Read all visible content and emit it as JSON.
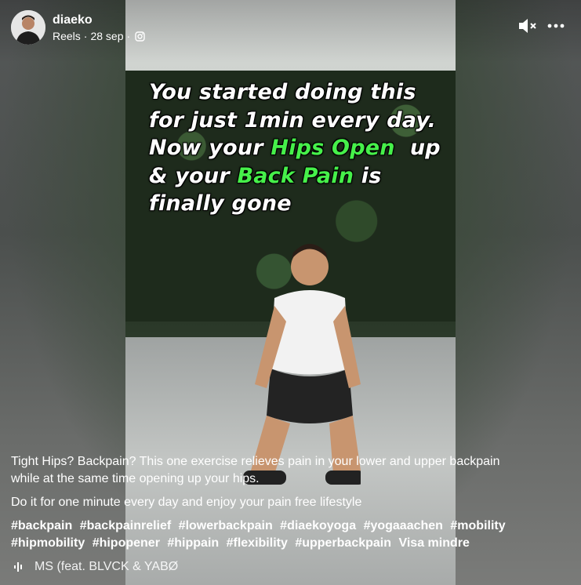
{
  "post": {
    "author": "diaeko",
    "source": "Reels",
    "dot1": "·",
    "date": "28 sep",
    "dot2": "·"
  },
  "video": {
    "overlay_line1": "You started doing this",
    "overlay_line2": "for just 1min every day.",
    "overlay_line3a": "Now your ",
    "overlay_line3b": "Hips Open",
    "overlay_line3c": "  up",
    "overlay_line4a": "& your ",
    "overlay_line4b": "Back Pain",
    "overlay_line4c": " is",
    "overlay_line5": "finally gone",
    "highlight_color": "#46f04a"
  },
  "caption": {
    "para1": "Tight Hips? Backpain? This one exercise relieves pain in your lower and upper backpain while at the same time opening up your hips.",
    "para2": "Do it for one minute every day and enjoy your pain free lifestyle",
    "hashtags": [
      "#backpain",
      "#backpainrelief",
      "#lowerbackpain",
      "#diaekoyoga",
      "#yogaaachen",
      "#mobility",
      "#hipmobility",
      "#hipopener",
      "#hippain",
      "#flexibility",
      "#upperbackpain"
    ],
    "see_more": "Visa mindre"
  },
  "music": {
    "text": "MS (feat. BLVCK & YABØ"
  },
  "icons": {
    "mute": "muted-speaker-icon",
    "more": "more-options-icon",
    "instagram": "instagram-icon",
    "music": "audio-waveform-icon"
  }
}
